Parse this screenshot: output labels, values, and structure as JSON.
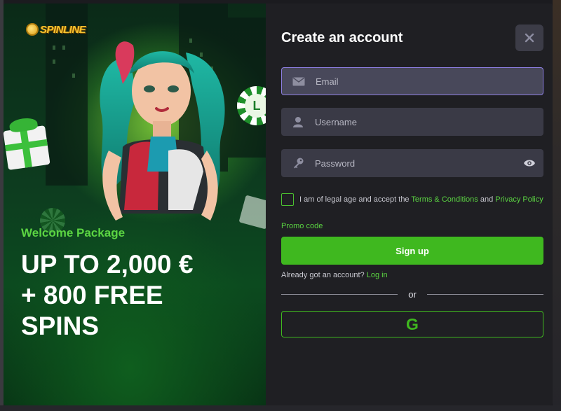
{
  "promo": {
    "logo_text": "SPINLINE",
    "welcome": "Welcome Package",
    "headline": [
      "UP TO 2,000 €",
      "+ 800 FREE",
      "SPINS"
    ]
  },
  "form": {
    "title": "Create an account",
    "email_placeholder": "Email",
    "username_placeholder": "Username",
    "password_placeholder": "Password",
    "consent_prefix": "I am of legal age and accept the",
    "terms_link": "Terms & Conditions",
    "consent_and": "and",
    "privacy_link": "Privacy Policy",
    "promo_code": "Promo code",
    "signup_label": "Sign up",
    "already_text": "Already got an account?",
    "login_link": "Log in",
    "or_label": "or",
    "google_letter": "G"
  },
  "icons": {
    "close": "close-icon",
    "email": "envelope-icon",
    "username": "user-icon",
    "password": "key-icon",
    "visibility": "eye-icon",
    "google": "google-icon"
  },
  "colors": {
    "accent_green": "#3fb81f",
    "link_green": "#5bd442",
    "panel_dark": "#1f1f23",
    "field_bg": "#3a3a46",
    "focus_border": "#8c7ee0"
  }
}
